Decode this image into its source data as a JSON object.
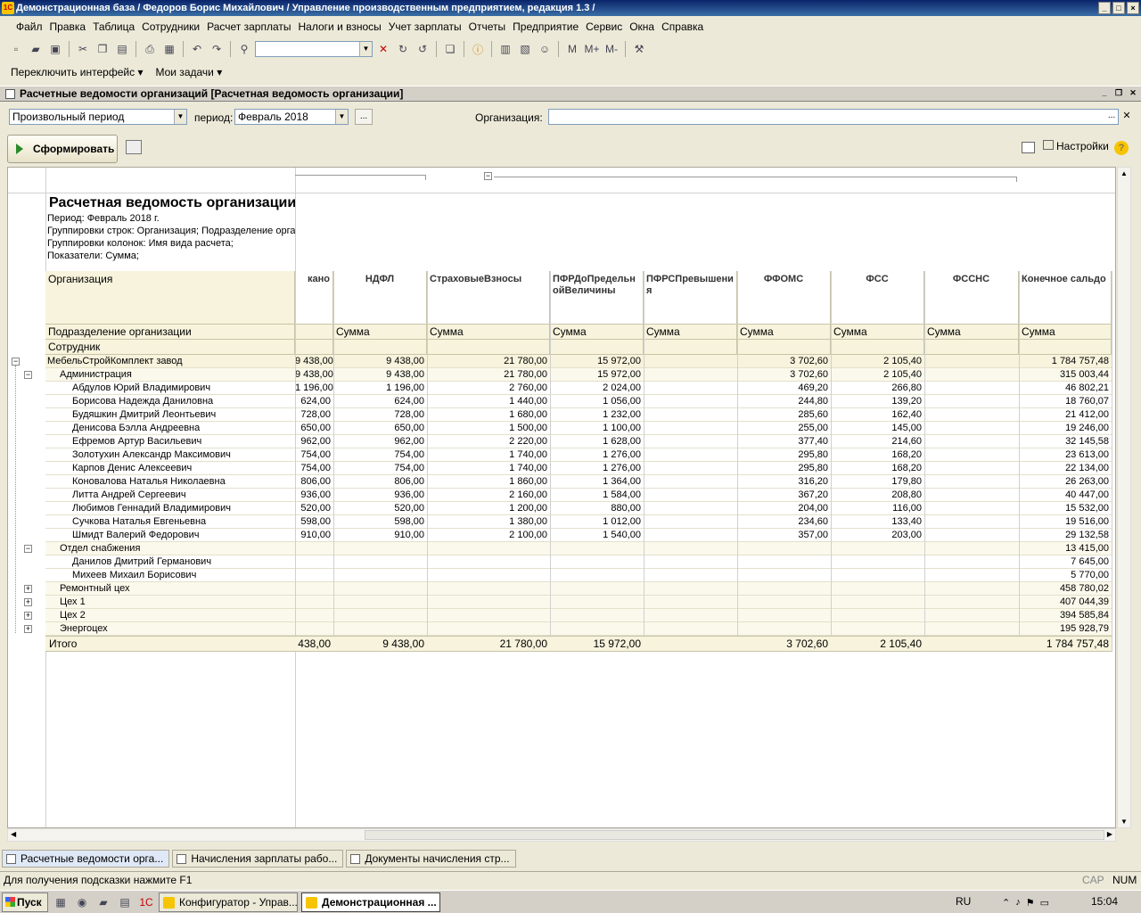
{
  "window": {
    "title": "Демонстрационная база / Федоров Борис Михайлович / Управление производственным предприятием, редакция 1.3 /"
  },
  "menu": [
    "Файл",
    "Правка",
    "Таблица",
    "Сотрудники",
    "Расчет зарплаты",
    "Налоги и взносы",
    "Учет зарплаты",
    "Отчеты",
    "Предприятие",
    "Сервис",
    "Окна",
    "Справка"
  ],
  "panel": {
    "switch_label": "Переключить интерфейс",
    "tasks_label": "Мои задачи"
  },
  "doc": {
    "title": "Расчетные ведомости организаций [Расчетная ведомость организации]"
  },
  "filters": {
    "period_type": "Произвольный период",
    "period_label": "период:",
    "period_value": "Февраль 2018",
    "org_label": "Организация:",
    "org_value": ""
  },
  "actions": {
    "generate": "Сформировать",
    "settings": "Настройки"
  },
  "report": {
    "title": "Расчетная ведомость организации",
    "meta": [
      "Период: Февраль 2018 г.",
      "Группировки строк: Организация; Подразделение организации",
      "Группировки колонок: Имя вида расчета;",
      "Показатели: Сумма;"
    ],
    "row_headers": {
      "org": "Организация",
      "dept": "Подразделение организации",
      "emp": "Сотрудник"
    },
    "columns": [
      "кано",
      "НДФЛ",
      "СтраховыеВзносы",
      "ПФРДоПредельнойВеличины",
      "ПФРСПревышения",
      "ФФОМС",
      "ФСС",
      "ФССНС",
      "Конечное сальдо"
    ],
    "measure": "Сумма",
    "rows": [
      {
        "name": "МебельСтройКомплект завод",
        "level": 0,
        "exp": "−",
        "v": [
          "9 438,00",
          "9 438,00",
          "21 780,00",
          "15 972,00",
          "",
          "3 702,60",
          "2 105,40",
          "",
          "1 784 757,48"
        ]
      },
      {
        "name": "Администрация",
        "level": 1,
        "exp": "−",
        "v": [
          "9 438,00",
          "9 438,00",
          "21 780,00",
          "15 972,00",
          "",
          "3 702,60",
          "2 105,40",
          "",
          "315 003,44"
        ]
      },
      {
        "name": "Абдулов Юрий Владимирович",
        "level": 2,
        "exp": "",
        "v": [
          "1 196,00",
          "1 196,00",
          "2 760,00",
          "2 024,00",
          "",
          "469,20",
          "266,80",
          "",
          "46 802,21"
        ]
      },
      {
        "name": "Борисова Надежда Даниловна",
        "level": 2,
        "exp": "",
        "v": [
          "624,00",
          "624,00",
          "1 440,00",
          "1 056,00",
          "",
          "244,80",
          "139,20",
          "",
          "18 760,07"
        ]
      },
      {
        "name": "Будяшкин Дмитрий Леонтьевич",
        "level": 2,
        "exp": "",
        "v": [
          "728,00",
          "728,00",
          "1 680,00",
          "1 232,00",
          "",
          "285,60",
          "162,40",
          "",
          "21 412,00"
        ]
      },
      {
        "name": "Денисова Бэлла Андреевна",
        "level": 2,
        "exp": "",
        "v": [
          "650,00",
          "650,00",
          "1 500,00",
          "1 100,00",
          "",
          "255,00",
          "145,00",
          "",
          "19 246,00"
        ]
      },
      {
        "name": "Ефремов Артур Васильевич",
        "level": 2,
        "exp": "",
        "v": [
          "962,00",
          "962,00",
          "2 220,00",
          "1 628,00",
          "",
          "377,40",
          "214,60",
          "",
          "32 145,58"
        ]
      },
      {
        "name": "Золотухин Александр Максимович",
        "level": 2,
        "exp": "",
        "v": [
          "754,00",
          "754,00",
          "1 740,00",
          "1 276,00",
          "",
          "295,80",
          "168,20",
          "",
          "23 613,00"
        ]
      },
      {
        "name": "Карпов Денис Алексеевич",
        "level": 2,
        "exp": "",
        "v": [
          "754,00",
          "754,00",
          "1 740,00",
          "1 276,00",
          "",
          "295,80",
          "168,20",
          "",
          "22 134,00"
        ]
      },
      {
        "name": "Коновалова Наталья Николаевна",
        "level": 2,
        "exp": "",
        "v": [
          "806,00",
          "806,00",
          "1 860,00",
          "1 364,00",
          "",
          "316,20",
          "179,80",
          "",
          "26 263,00"
        ]
      },
      {
        "name": "Литта Андрей Сергеевич",
        "level": 2,
        "exp": "",
        "v": [
          "936,00",
          "936,00",
          "2 160,00",
          "1 584,00",
          "",
          "367,20",
          "208,80",
          "",
          "40 447,00"
        ]
      },
      {
        "name": "Любимов Геннадий Владимирович",
        "level": 2,
        "exp": "",
        "v": [
          "520,00",
          "520,00",
          "1 200,00",
          "880,00",
          "",
          "204,00",
          "116,00",
          "",
          "15 532,00"
        ]
      },
      {
        "name": "Сучкова Наталья Евгеньевна",
        "level": 2,
        "exp": "",
        "v": [
          "598,00",
          "598,00",
          "1 380,00",
          "1 012,00",
          "",
          "234,60",
          "133,40",
          "",
          "19 516,00"
        ]
      },
      {
        "name": "Шмидт Валерий Федорович",
        "level": 2,
        "exp": "",
        "v": [
          "910,00",
          "910,00",
          "2 100,00",
          "1 540,00",
          "",
          "357,00",
          "203,00",
          "",
          "29 132,58"
        ]
      },
      {
        "name": "Отдел снабжения",
        "level": 1,
        "exp": "−",
        "v": [
          "",
          "",
          "",
          "",
          "",
          "",
          "",
          "",
          "13 415,00"
        ]
      },
      {
        "name": "Данилов Дмитрий Германович",
        "level": 2,
        "exp": "",
        "v": [
          "",
          "",
          "",
          "",
          "",
          "",
          "",
          "",
          "7 645,00"
        ]
      },
      {
        "name": "Михеев Михаил Борисович",
        "level": 2,
        "exp": "",
        "v": [
          "",
          "",
          "",
          "",
          "",
          "",
          "",
          "",
          "5 770,00"
        ]
      },
      {
        "name": "Ремонтный цех",
        "level": 1,
        "exp": "+",
        "v": [
          "",
          "",
          "",
          "",
          "",
          "",
          "",
          "",
          "458 780,02"
        ]
      },
      {
        "name": "Цех 1",
        "level": 1,
        "exp": "+",
        "v": [
          "",
          "",
          "",
          "",
          "",
          "",
          "",
          "",
          "407 044,39"
        ]
      },
      {
        "name": "Цех 2",
        "level": 1,
        "exp": "+",
        "v": [
          "",
          "",
          "",
          "",
          "",
          "",
          "",
          "",
          "394 585,84"
        ]
      },
      {
        "name": "Энергоцех",
        "level": 1,
        "exp": "+",
        "v": [
          "",
          "",
          "",
          "",
          "",
          "",
          "",
          "",
          "195 928,79"
        ]
      }
    ],
    "total": {
      "label": "Итого",
      "v": [
        "438,00",
        "9 438,00",
        "21 780,00",
        "15 972,00",
        "",
        "3 702,60",
        "2 105,40",
        "",
        "1 784 757,48"
      ]
    }
  },
  "tabs": [
    "Расчетные ведомости орга...",
    "Начисления зарплаты рабо...",
    "Документы начисления стр..."
  ],
  "status": {
    "hint": "Для получения подсказки нажмите F1",
    "cap": "CAP",
    "num": "NUM"
  },
  "taskbar": {
    "start": "Пуск",
    "tasks": [
      "Конфигуратор - Управ...",
      "Демонстрационная ..."
    ],
    "lang": "RU",
    "clock": "15:04"
  }
}
